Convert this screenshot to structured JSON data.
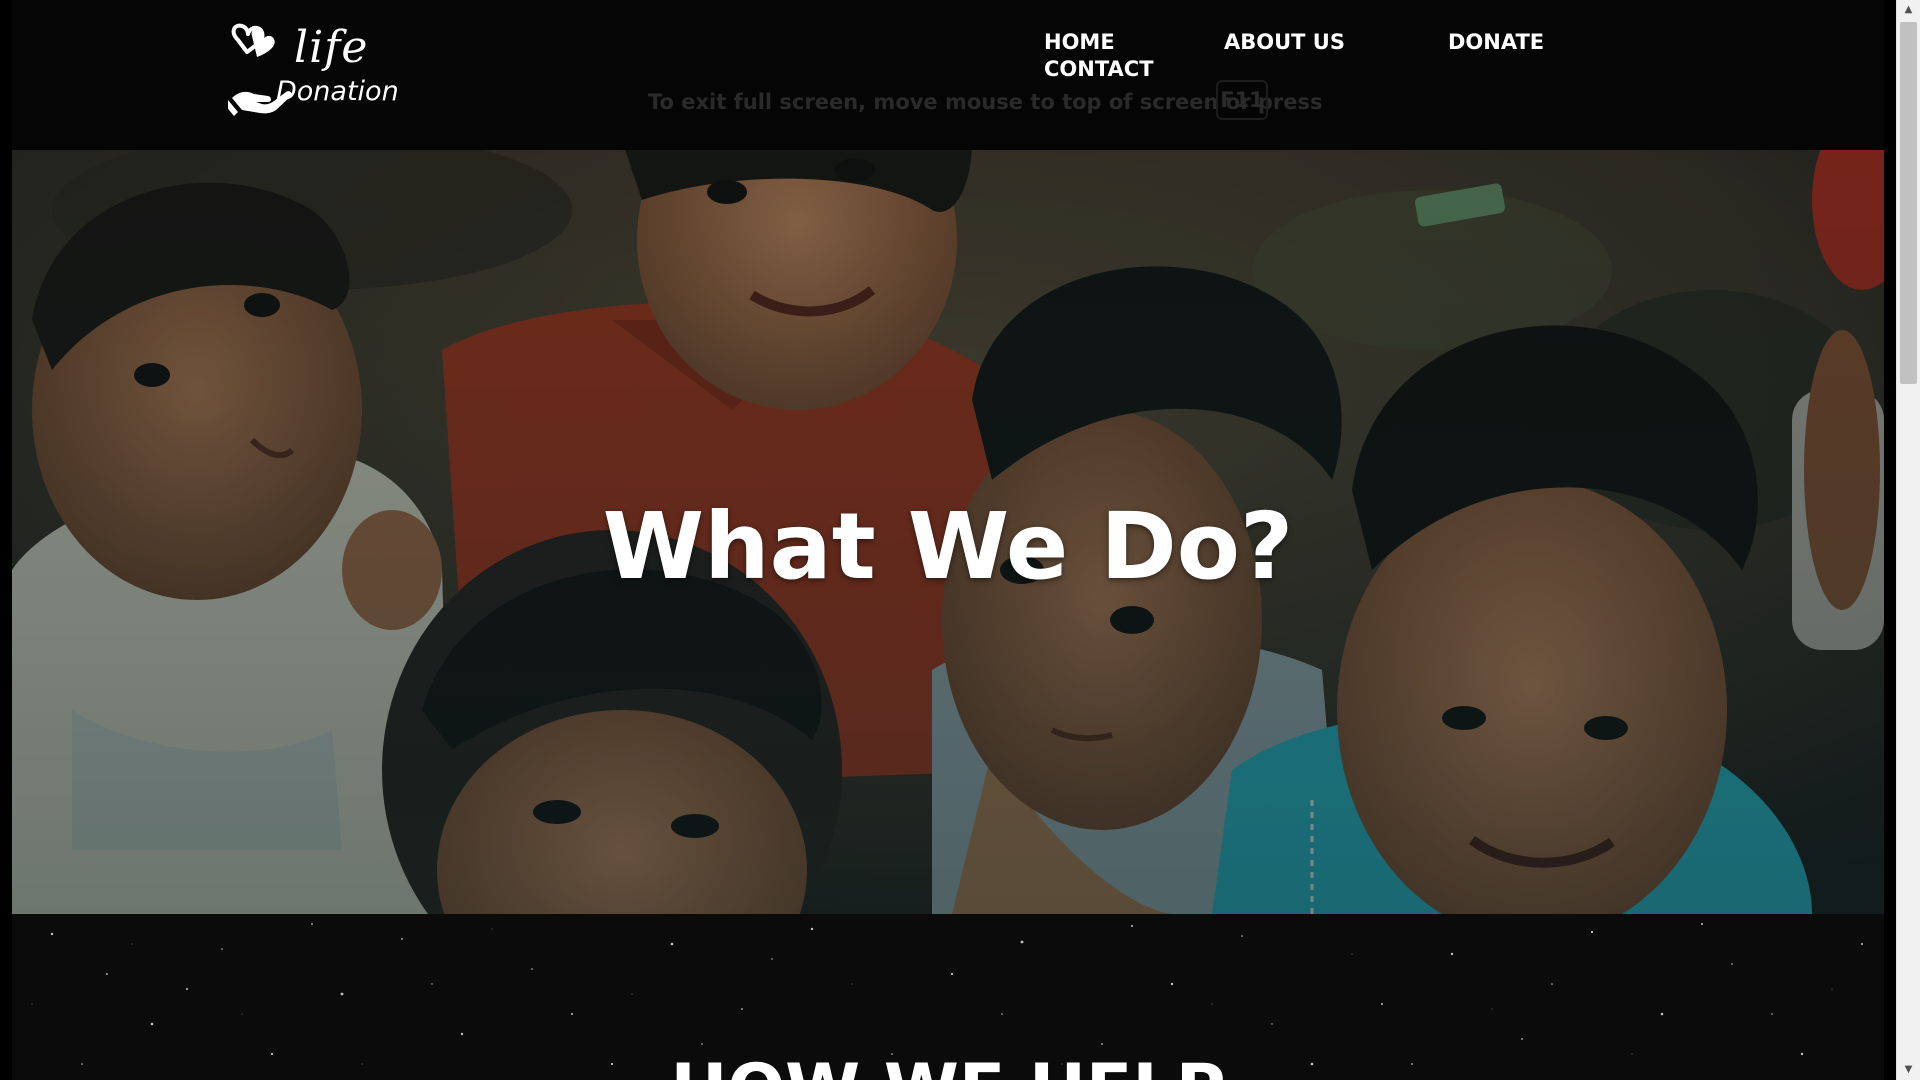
{
  "brand": {
    "word_top": "life",
    "word_bottom": "Donation"
  },
  "nav": {
    "home": "HOME",
    "about": "ABOUT US",
    "donate": "DONATE",
    "contact": "CONTACT"
  },
  "fullscreen_hint": {
    "text": "To exit full screen, move mouse to top of screen or press",
    "key": "F11"
  },
  "hero": {
    "title": "What We Do?"
  },
  "help": {
    "title": "HOW WE HELP"
  },
  "scrollbar": {
    "up_icon": "▲",
    "down_icon": "▼"
  }
}
